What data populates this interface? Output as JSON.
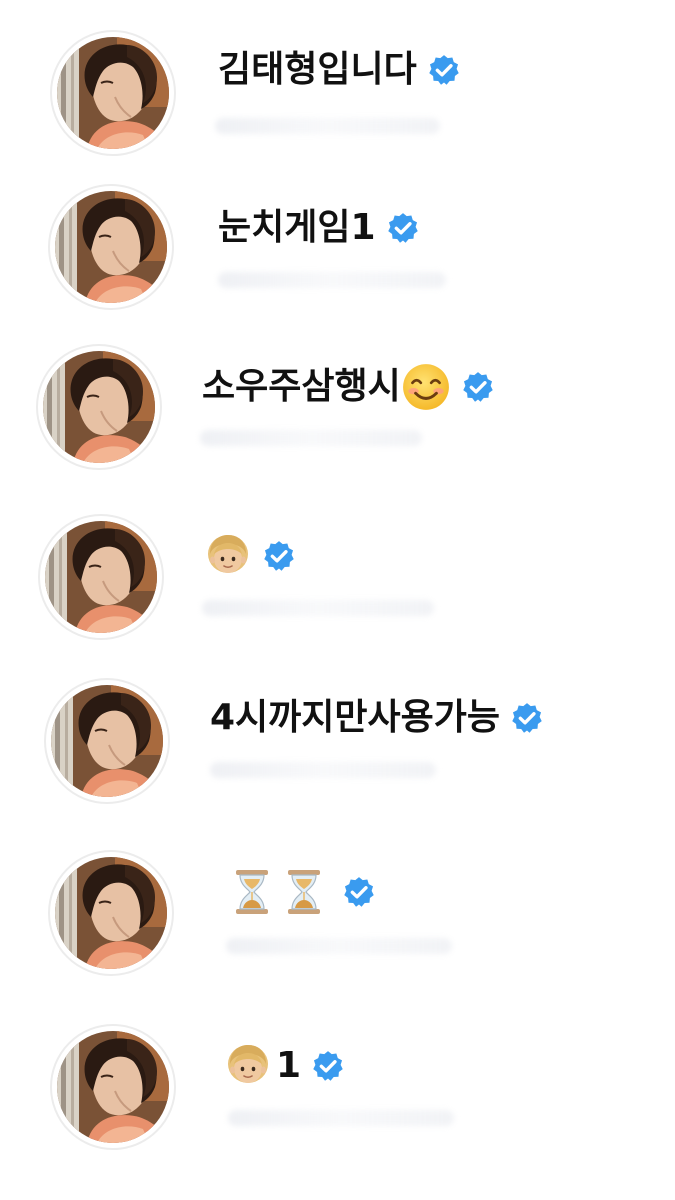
{
  "accounts": [
    {
      "name": "김태형입니다",
      "badge_icon": "verified-badge-icon"
    },
    {
      "name": "눈치게임1",
      "badge_icon": "verified-badge-icon"
    },
    {
      "name": "소우주삼행시",
      "emoji_icon": "smiling-face-icon",
      "badge_icon": "verified-badge-icon"
    },
    {
      "name": "",
      "emoji_icon": "person-blond-hair-icon",
      "badge_icon": "verified-badge-icon"
    },
    {
      "name": "4시까지만사용가능",
      "badge_icon": "verified-badge-icon"
    },
    {
      "name": "",
      "emoji_icon": "hourglass-icon",
      "emoji_count": 2,
      "badge_icon": "verified-badge-icon"
    },
    {
      "name": "1",
      "emoji_icon": "person-blond-hair-icon",
      "badge_icon": "verified-badge-icon"
    }
  ],
  "colors": {
    "verified_blue": "#3a9bef",
    "text": "#111111",
    "avatar_ring": "#ececec"
  }
}
